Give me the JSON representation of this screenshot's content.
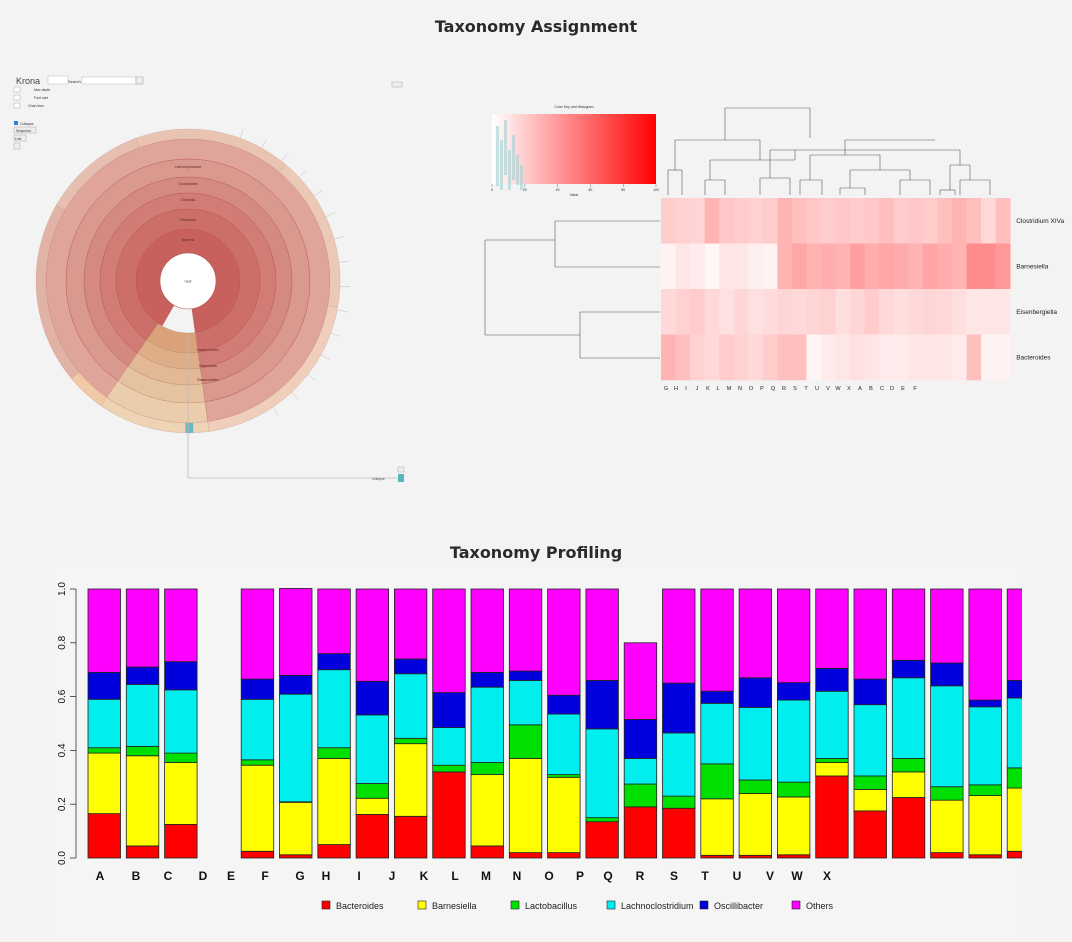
{
  "titles": {
    "assignment": "Taxonomy Assignment",
    "profiling": "Taxonomy Profiling"
  },
  "krona": {
    "logo": "Krona",
    "search_label": "Search",
    "ring_labels": [
      "Bacteria",
      "Firmicutes",
      "Clostridia",
      "Clostridiales",
      "Lachnospiraceae",
      "Bacteroidetes",
      "Bacteroidia",
      "Bacteroidales"
    ],
    "center_label": "root",
    "controls": [
      "Max depth",
      "Font size",
      "Chart size",
      "Collapse",
      "Snapshot",
      "Link"
    ],
    "footer_label": "collapse"
  },
  "heatmap": {
    "key_title": "Color Key and Histogram",
    "key_xlabel": "Value",
    "key_ticks": [
      "0",
      "20",
      "40",
      "60",
      "80",
      "100"
    ],
    "rows": [
      "Clostridium XIVa",
      "Barnesiella",
      "Eisenbergiella",
      "Bacteroides"
    ],
    "columns": [
      "G",
      "H",
      "I",
      "J",
      "K",
      "L",
      "M",
      "N",
      "O",
      "P",
      "Q",
      "R",
      "S",
      "T",
      "U",
      "V",
      "W",
      "X",
      "A",
      "B",
      "C",
      "D",
      "E",
      "F"
    ],
    "intensity": [
      [
        0.2,
        0.18,
        0.17,
        0.3,
        0.22,
        0.2,
        0.18,
        0.2,
        0.3,
        0.25,
        0.22,
        0.2,
        0.22,
        0.2,
        0.22,
        0.25,
        0.2,
        0.22,
        0.2,
        0.25,
        0.3,
        0.25,
        0.15,
        0.25
      ],
      [
        0.05,
        0.1,
        0.08,
        0.03,
        0.1,
        0.1,
        0.06,
        0.05,
        0.3,
        0.35,
        0.3,
        0.32,
        0.3,
        0.38,
        0.32,
        0.35,
        0.33,
        0.3,
        0.36,
        0.32,
        0.3,
        0.45,
        0.45,
        0.4
      ],
      [
        0.15,
        0.18,
        0.2,
        0.15,
        0.12,
        0.16,
        0.12,
        0.14,
        0.16,
        0.15,
        0.17,
        0.18,
        0.13,
        0.16,
        0.2,
        0.15,
        0.13,
        0.15,
        0.16,
        0.15,
        0.13,
        0.1,
        0.1,
        0.1
      ],
      [
        0.3,
        0.25,
        0.18,
        0.15,
        0.2,
        0.18,
        0.15,
        0.2,
        0.25,
        0.25,
        0.04,
        0.08,
        0.1,
        0.12,
        0.1,
        0.08,
        0.08,
        0.1,
        0.1,
        0.1,
        0.08,
        0.25,
        0.05,
        0.05
      ]
    ]
  },
  "chart_data": {
    "type": "bar",
    "stacked": true,
    "categories": [
      "A",
      "B",
      "C",
      "D",
      "E",
      "F",
      "G",
      "H",
      "I",
      "J",
      "K",
      "L",
      "M",
      "N",
      "O",
      "P",
      "Q",
      "R",
      "S",
      "T",
      "U",
      "V",
      "W",
      "X"
    ],
    "ylim": [
      0,
      1
    ],
    "yticks": [
      "0.0",
      "0.2",
      "0.4",
      "0.6",
      "0.8",
      "1.0"
    ],
    "series": [
      {
        "name": "Bacteroides",
        "color": "#ff0000",
        "values": [
          0.165,
          0.045,
          0.125,
          0.0,
          0.025,
          0.012,
          0.05,
          0.162,
          0.155,
          0.32,
          0.045,
          0.02,
          0.02,
          0.135,
          0.19,
          0.185,
          0.01,
          0.01,
          0.012,
          0.305,
          0.175,
          0.225,
          0.02,
          0.012,
          0.025
        ]
      },
      {
        "name": "Barnesiella",
        "color": "#ffff00",
        "values": [
          0.225,
          0.335,
          0.23,
          0.0,
          0.32,
          0.195,
          0.32,
          0.06,
          0.27,
          0.0,
          0.265,
          0.35,
          0.28,
          0.0,
          0.0,
          0.0,
          0.21,
          0.23,
          0.215,
          0.05,
          0.08,
          0.095,
          0.195,
          0.22,
          0.235
        ]
      },
      {
        "name": "Lactobacillus",
        "color": "#00e000",
        "values": [
          0.02,
          0.035,
          0.035,
          0.0,
          0.02,
          0.002,
          0.04,
          0.055,
          0.02,
          0.025,
          0.045,
          0.125,
          0.01,
          0.015,
          0.085,
          0.045,
          0.13,
          0.05,
          0.055,
          0.015,
          0.05,
          0.05,
          0.05,
          0.04,
          0.075
        ]
      },
      {
        "name": "Lachnoclostridium",
        "color": "#00eeee",
        "values": [
          0.18,
          0.23,
          0.235,
          0.0,
          0.225,
          0.4,
          0.29,
          0.255,
          0.24,
          0.14,
          0.28,
          0.165,
          0.225,
          0.33,
          0.095,
          0.235,
          0.225,
          0.27,
          0.305,
          0.25,
          0.265,
          0.3,
          0.375,
          0.29,
          0.26
        ]
      },
      {
        "name": "Oscillibacter",
        "color": "#0000dd",
        "values": [
          0.1,
          0.065,
          0.105,
          0.0,
          0.075,
          0.07,
          0.06,
          0.125,
          0.055,
          0.13,
          0.055,
          0.035,
          0.07,
          0.18,
          0.145,
          0.185,
          0.045,
          0.11,
          0.065,
          0.085,
          0.095,
          0.065,
          0.085,
          0.025,
          0.065
        ]
      },
      {
        "name": "Others",
        "color": "#ff00ff",
        "values": [
          0.31,
          0.29,
          0.27,
          0.0,
          0.335,
          0.323,
          0.24,
          0.343,
          0.26,
          0.385,
          0.31,
          0.305,
          0.395,
          0.34,
          0.285,
          0.35,
          0.38,
          0.33,
          0.348,
          0.295,
          0.335,
          0.265,
          0.275,
          0.413,
          0.34
        ]
      }
    ],
    "legend_position": "bottom"
  }
}
